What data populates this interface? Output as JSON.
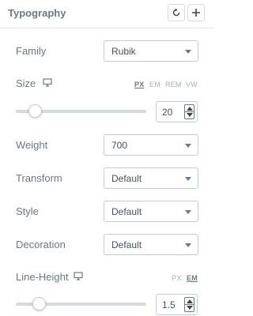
{
  "panel": {
    "title": "Typography",
    "reset_icon": "reset-icon",
    "add_icon": "plus-icon"
  },
  "family": {
    "label": "Family",
    "value": "Rubik"
  },
  "size": {
    "label": "Size",
    "device_icon": "desktop-monitor-icon",
    "units": [
      "PX",
      "EM",
      "REM",
      "VW"
    ],
    "active_unit": "PX",
    "value": "20",
    "slider_fraction": 0.1
  },
  "weight": {
    "label": "Weight",
    "value": "700"
  },
  "transform": {
    "label": "Transform",
    "value": "Default"
  },
  "style": {
    "label": "Style",
    "value": "Default"
  },
  "decoration": {
    "label": "Decoration",
    "value": "Default"
  },
  "line_height": {
    "label": "Line-Height",
    "device_icon": "desktop-monitor-icon",
    "units": [
      "PX",
      "EM"
    ],
    "active_unit": "EM",
    "value": "1.5",
    "slider_fraction": 0.13
  },
  "colors": {
    "label_text": "#6d7882",
    "border": "#c6cbd0",
    "track": "#d5dadf",
    "unit_inactive": "#a4afb7"
  }
}
